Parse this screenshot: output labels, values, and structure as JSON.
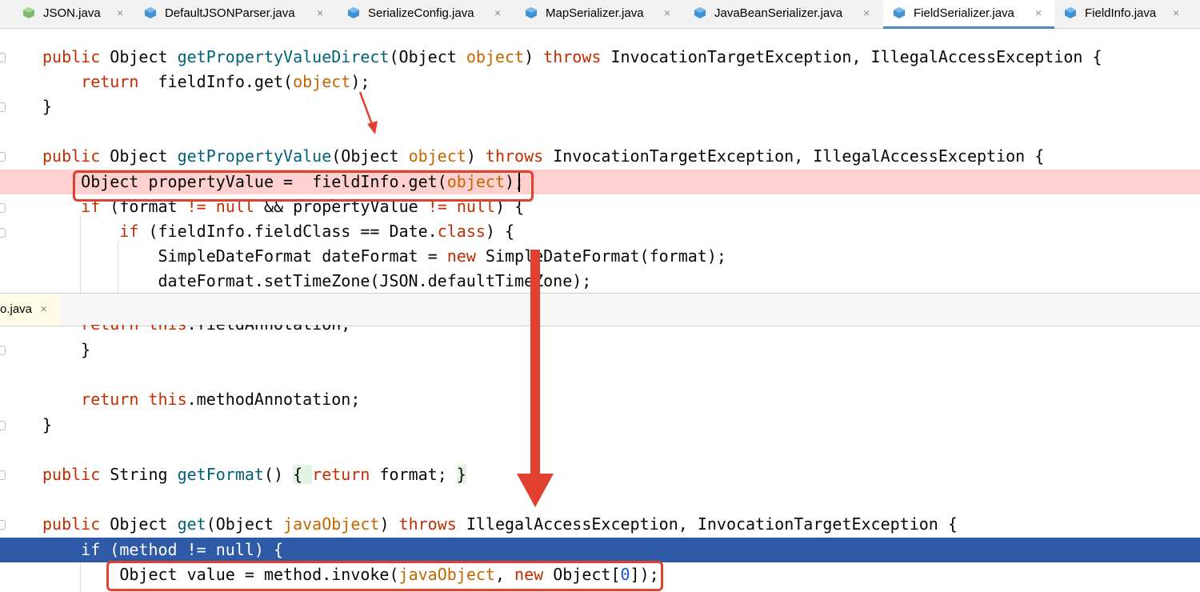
{
  "tabs": [
    {
      "label": "JSON.java",
      "icon": "java-class-icon",
      "active": false
    },
    {
      "label": "DefaultJSONParser.java",
      "icon": "java-class-icon",
      "active": false
    },
    {
      "label": "SerializeConfig.java",
      "icon": "java-class-icon",
      "active": false
    },
    {
      "label": "MapSerializer.java",
      "icon": "java-class-icon",
      "active": false
    },
    {
      "label": "JavaBeanSerializer.java",
      "icon": "java-class-icon",
      "active": false
    },
    {
      "label": "FieldSerializer.java",
      "icon": "java-class-icon",
      "active": true
    },
    {
      "label": "FieldInfo.java",
      "icon": "java-class-icon",
      "active": false
    }
  ],
  "close_glyph": "×",
  "split_tab": {
    "label": "o.java"
  },
  "code_top": {
    "l1": [
      "public",
      " Object ",
      "getPropertyValueDirect",
      "(Object ",
      "object",
      ") ",
      "throws",
      " InvocationTargetException, IllegalAccessException {"
    ],
    "l2": [
      "    return",
      "  fieldInfo.get(",
      "object",
      ");"
    ],
    "l3": "}",
    "l5": [
      "public",
      " Object ",
      "getPropertyValue",
      "(Object ",
      "object",
      ") ",
      "throws",
      " InvocationTargetException, IllegalAccessException {"
    ],
    "l6": [
      "    Object propertyValue =  fieldInfo.get(",
      "object",
      ");"
    ],
    "l7": [
      "    ",
      "if",
      " (format ",
      "!=",
      " ",
      "null",
      " && propertyValue ",
      "!=",
      " ",
      "null",
      ") {"
    ],
    "l8": [
      "        ",
      "if",
      " (fieldInfo.fieldClass == Date.",
      "class",
      ") {"
    ],
    "l9": [
      "            SimpleDateFormat dateFormat = ",
      "new",
      " SimpleDateFormat(format);"
    ],
    "l10": "            dateFormat.setTimeZone(JSON.defaultTimeZone);"
  },
  "code_bottom": {
    "b0": [
      "    ",
      "return this",
      ".fieldAnnotation;"
    ],
    "b1": "    }",
    "b3": [
      "    ",
      "return",
      " ",
      "this",
      ".methodAnnotation;"
    ],
    "b4": "}",
    "b6": [
      "public",
      " String ",
      "getFormat",
      "() ",
      "{ ",
      "return",
      " format; ",
      "}"
    ],
    "b8": [
      "public",
      " Object ",
      "get",
      "(Object ",
      "javaObject",
      ") ",
      "throws",
      " IllegalAccessException, InvocationTargetException {"
    ],
    "b9": "    if (method != null) {",
    "b10": [
      "        Object value = method.invoke(",
      "javaObject",
      ", ",
      "new",
      " Object[",
      "0",
      "]);"
    ]
  },
  "colors": {
    "keyword": "#c22d00",
    "method": "#00627a",
    "param": "#c26600",
    "highlight_error": "#ffd0d0",
    "highlight_exec": "#2e5aa7",
    "annotation": "#e2402e"
  }
}
